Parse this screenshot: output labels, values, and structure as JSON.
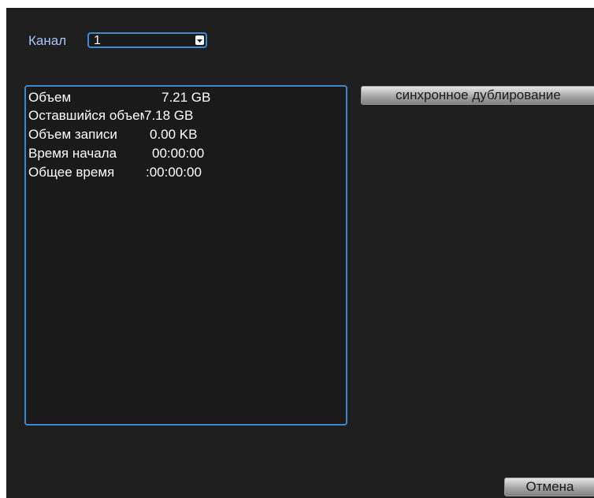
{
  "channel": {
    "label": "Канал",
    "selected": "1"
  },
  "info": [
    {
      "label": "Объем",
      "value": "7.21 GB"
    },
    {
      "label": "Оставшийся объем",
      "value": "7.18 GB"
    },
    {
      "label": "Объем записи",
      "value": "0.00 KB"
    },
    {
      "label": "Время начала",
      "value": "00:00:00"
    },
    {
      "label": "Общее время",
      "value": ":00:00:00"
    }
  ],
  "buttons": {
    "sync_label": "синхронное дублирование",
    "cancel_label": "Отмена"
  },
  "colors": {
    "background": "#1e1e1e",
    "border_accent": "#3d86c8",
    "label_text": "#a9c4ff"
  }
}
